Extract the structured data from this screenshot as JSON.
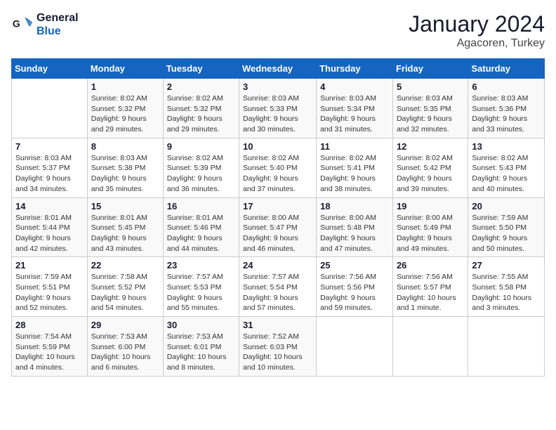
{
  "logo": {
    "line1": "General",
    "line2": "Blue"
  },
  "title": "January 2024",
  "location": "Agacoren, Turkey",
  "days_of_week": [
    "Sunday",
    "Monday",
    "Tuesday",
    "Wednesday",
    "Thursday",
    "Friday",
    "Saturday"
  ],
  "weeks": [
    [
      {
        "day": "",
        "info": ""
      },
      {
        "day": "1",
        "info": "Sunrise: 8:02 AM\nSunset: 5:32 PM\nDaylight: 9 hours and 29 minutes."
      },
      {
        "day": "2",
        "info": "Sunrise: 8:02 AM\nSunset: 5:32 PM\nDaylight: 9 hours and 29 minutes."
      },
      {
        "day": "3",
        "info": "Sunrise: 8:03 AM\nSunset: 5:33 PM\nDaylight: 9 hours and 30 minutes."
      },
      {
        "day": "4",
        "info": "Sunrise: 8:03 AM\nSunset: 5:34 PM\nDaylight: 9 hours and 31 minutes."
      },
      {
        "day": "5",
        "info": "Sunrise: 8:03 AM\nSunset: 5:35 PM\nDaylight: 9 hours and 32 minutes."
      },
      {
        "day": "6",
        "info": "Sunrise: 8:03 AM\nSunset: 5:36 PM\nDaylight: 9 hours and 33 minutes."
      }
    ],
    [
      {
        "day": "7",
        "info": "Sunrise: 8:03 AM\nSunset: 5:37 PM\nDaylight: 9 hours and 34 minutes."
      },
      {
        "day": "8",
        "info": "Sunrise: 8:03 AM\nSunset: 5:38 PM\nDaylight: 9 hours and 35 minutes."
      },
      {
        "day": "9",
        "info": "Sunrise: 8:02 AM\nSunset: 5:39 PM\nDaylight: 9 hours and 36 minutes."
      },
      {
        "day": "10",
        "info": "Sunrise: 8:02 AM\nSunset: 5:40 PM\nDaylight: 9 hours and 37 minutes."
      },
      {
        "day": "11",
        "info": "Sunrise: 8:02 AM\nSunset: 5:41 PM\nDaylight: 9 hours and 38 minutes."
      },
      {
        "day": "12",
        "info": "Sunrise: 8:02 AM\nSunset: 5:42 PM\nDaylight: 9 hours and 39 minutes."
      },
      {
        "day": "13",
        "info": "Sunrise: 8:02 AM\nSunset: 5:43 PM\nDaylight: 9 hours and 40 minutes."
      }
    ],
    [
      {
        "day": "14",
        "info": "Sunrise: 8:01 AM\nSunset: 5:44 PM\nDaylight: 9 hours and 42 minutes."
      },
      {
        "day": "15",
        "info": "Sunrise: 8:01 AM\nSunset: 5:45 PM\nDaylight: 9 hours and 43 minutes."
      },
      {
        "day": "16",
        "info": "Sunrise: 8:01 AM\nSunset: 5:46 PM\nDaylight: 9 hours and 44 minutes."
      },
      {
        "day": "17",
        "info": "Sunrise: 8:00 AM\nSunset: 5:47 PM\nDaylight: 9 hours and 46 minutes."
      },
      {
        "day": "18",
        "info": "Sunrise: 8:00 AM\nSunset: 5:48 PM\nDaylight: 9 hours and 47 minutes."
      },
      {
        "day": "19",
        "info": "Sunrise: 8:00 AM\nSunset: 5:49 PM\nDaylight: 9 hours and 49 minutes."
      },
      {
        "day": "20",
        "info": "Sunrise: 7:59 AM\nSunset: 5:50 PM\nDaylight: 9 hours and 50 minutes."
      }
    ],
    [
      {
        "day": "21",
        "info": "Sunrise: 7:59 AM\nSunset: 5:51 PM\nDaylight: 9 hours and 52 minutes."
      },
      {
        "day": "22",
        "info": "Sunrise: 7:58 AM\nSunset: 5:52 PM\nDaylight: 9 hours and 54 minutes."
      },
      {
        "day": "23",
        "info": "Sunrise: 7:57 AM\nSunset: 5:53 PM\nDaylight: 9 hours and 55 minutes."
      },
      {
        "day": "24",
        "info": "Sunrise: 7:57 AM\nSunset: 5:54 PM\nDaylight: 9 hours and 57 minutes."
      },
      {
        "day": "25",
        "info": "Sunrise: 7:56 AM\nSunset: 5:56 PM\nDaylight: 9 hours and 59 minutes."
      },
      {
        "day": "26",
        "info": "Sunrise: 7:56 AM\nSunset: 5:57 PM\nDaylight: 10 hours and 1 minute."
      },
      {
        "day": "27",
        "info": "Sunrise: 7:55 AM\nSunset: 5:58 PM\nDaylight: 10 hours and 3 minutes."
      }
    ],
    [
      {
        "day": "28",
        "info": "Sunrise: 7:54 AM\nSunset: 5:59 PM\nDaylight: 10 hours and 4 minutes."
      },
      {
        "day": "29",
        "info": "Sunrise: 7:53 AM\nSunset: 6:00 PM\nDaylight: 10 hours and 6 minutes."
      },
      {
        "day": "30",
        "info": "Sunrise: 7:53 AM\nSunset: 6:01 PM\nDaylight: 10 hours and 8 minutes."
      },
      {
        "day": "31",
        "info": "Sunrise: 7:52 AM\nSunset: 6:03 PM\nDaylight: 10 hours and 10 minutes."
      },
      {
        "day": "",
        "info": ""
      },
      {
        "day": "",
        "info": ""
      },
      {
        "day": "",
        "info": ""
      }
    ]
  ]
}
